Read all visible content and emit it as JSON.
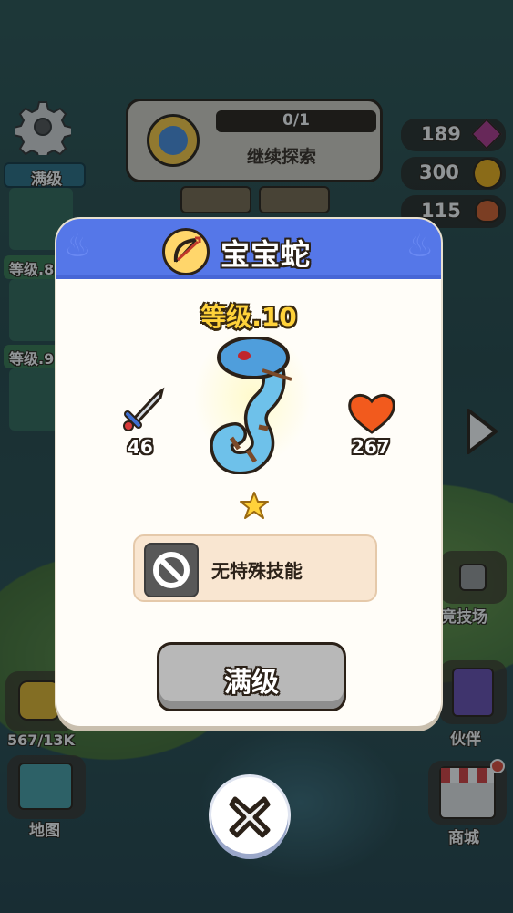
{
  "hud": {
    "quest_progress": "0/1",
    "quest_label": "继续探索",
    "max_level_tab": "满级",
    "level_tag_1": "等级.8",
    "level_tag_2": "等级.9",
    "gems": "189",
    "coins": "300",
    "food": "115",
    "energy": "567/13K",
    "map_label": "地图",
    "arena_label": "竞技场",
    "partner_label": "伙伴",
    "shop_label": "商城"
  },
  "modal": {
    "title": "宝宝蛇",
    "level": "等级.10",
    "attack": "46",
    "health": "267",
    "stars": 1,
    "skill_label": "无特殊技能",
    "max_button": "满级",
    "header_color": "#5577e8",
    "class_icon": "bow-icon"
  }
}
